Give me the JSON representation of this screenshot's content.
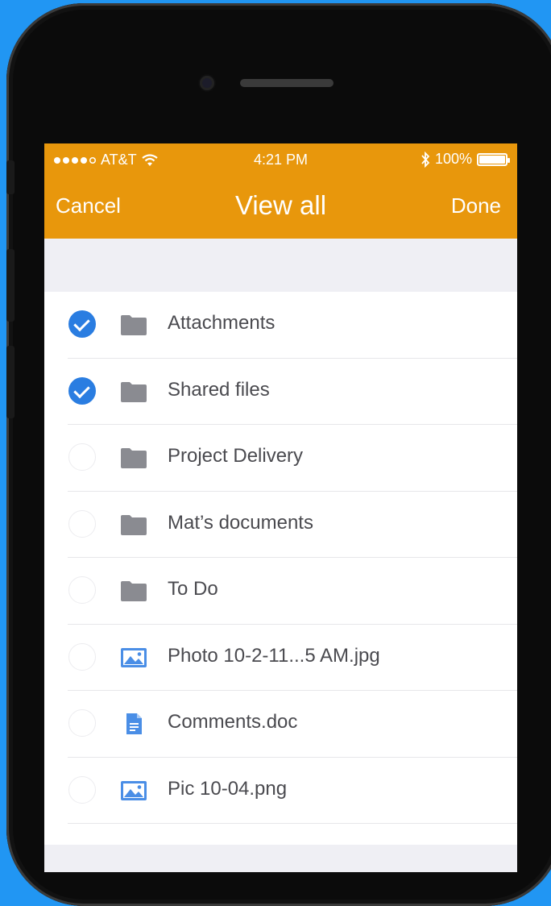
{
  "status_bar": {
    "carrier": "AT&T",
    "time": "4:21 PM",
    "battery_text": "100%",
    "battery_level": 1.0,
    "signal_bars_filled": 4,
    "signal_bars_total": 5
  },
  "nav": {
    "cancel_label": "Cancel",
    "title": "View all",
    "done_label": "Done"
  },
  "items": [
    {
      "label": "Attachments",
      "type": "folder",
      "checked": true
    },
    {
      "label": "Shared files",
      "type": "folder",
      "checked": true
    },
    {
      "label": "Project Delivery",
      "type": "folder",
      "checked": false
    },
    {
      "label": "Mat’s documents",
      "type": "folder",
      "checked": false
    },
    {
      "label": "To Do",
      "type": "folder",
      "checked": false
    },
    {
      "label": "Photo 10-2-11...5 AM.jpg",
      "type": "image",
      "checked": false
    },
    {
      "label": "Comments.doc",
      "type": "document",
      "checked": false
    },
    {
      "label": "Pic 10-04.png",
      "type": "image",
      "checked": false
    }
  ],
  "icons": {
    "folder": "folder-icon",
    "image": "image-icon",
    "document": "document-icon",
    "wifi": "wifi-icon",
    "bluetooth": "bluetooth-icon",
    "battery": "battery-icon"
  },
  "colors": {
    "background": "#2196f3",
    "nav_bar": "#e8970c",
    "checkbox_selected": "#2a7de1",
    "folder_icon": "#8a8b91",
    "file_icon": "#4a8ee6"
  }
}
